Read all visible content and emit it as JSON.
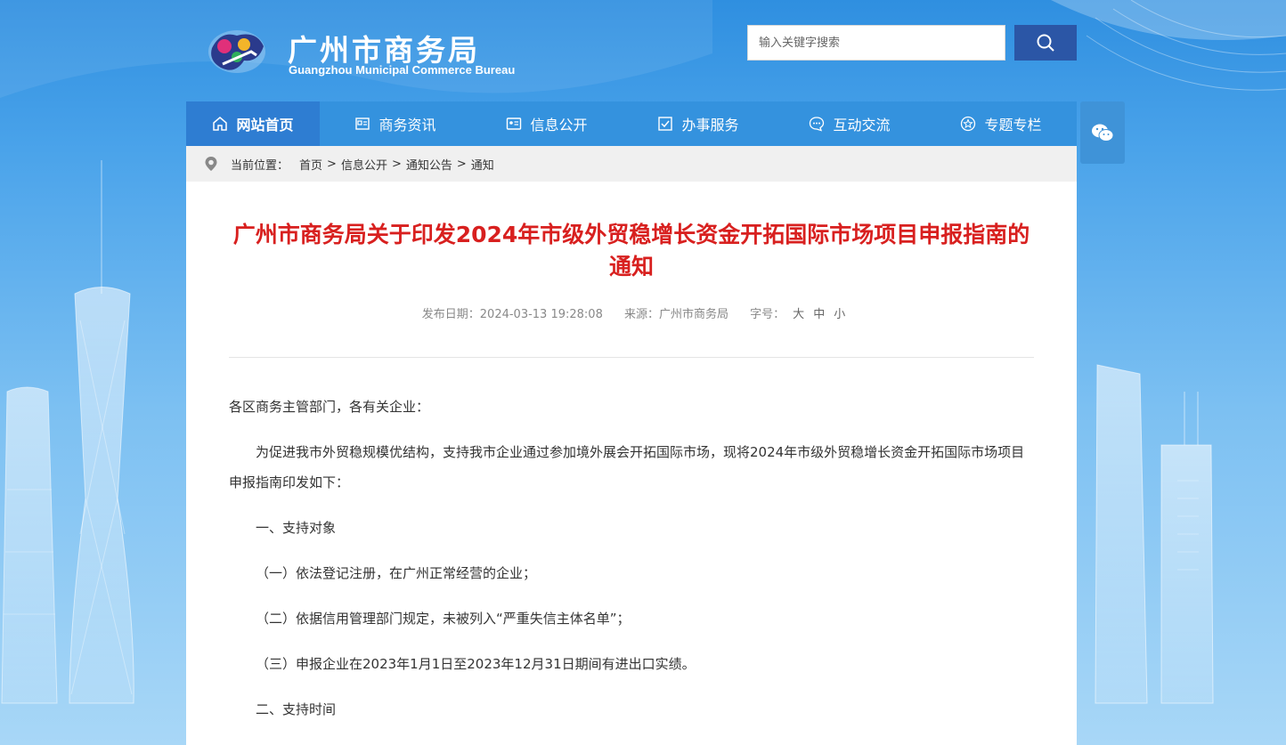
{
  "header": {
    "title": "广州市商务局",
    "subtitle": "Guangzhou Municipal Commerce Bureau",
    "search_placeholder": "输入关键字搜索"
  },
  "nav": {
    "items": [
      {
        "label": "网站首页",
        "icon": "home-icon",
        "active": true
      },
      {
        "label": "商务资讯",
        "icon": "news-icon"
      },
      {
        "label": "信息公开",
        "icon": "info-card-icon"
      },
      {
        "label": "办事服务",
        "icon": "checkbox-icon"
      },
      {
        "label": "互动交流",
        "icon": "chat-bubble-icon"
      },
      {
        "label": "专题专栏",
        "icon": "star-icon"
      }
    ]
  },
  "breadcrumb": {
    "prefix": "当前位置：",
    "items": [
      "首页",
      "信息公开",
      "通知公告",
      "通知"
    ],
    "sep": ">"
  },
  "article": {
    "title": "广州市商务局关于印发2024年市级外贸稳增长资金开拓国际市场项目申报指南的通知",
    "publish_date": "发布日期：2024-03-13 19:28:08",
    "source": "来源：广州市商务局",
    "font_size_label": "字号：",
    "size_large": "大",
    "size_medium": "中",
    "size_small": "小",
    "paragraphs": [
      "各区商务主管部门，各有关企业：",
      "为促进我市外贸稳规模优结构，支持我市企业通过参加境外展会开拓国际市场，现将2024年市级外贸稳增长资金开拓国际市场项目申报指南印发如下：",
      "一、支持对象",
      "（一）依法登记注册，在广州正常经营的企业；",
      "（二）依据信用管理部门规定，未被列入“严重失信主体名单”；",
      "（三）申报企业在2023年1月1日至2023年12月31日期间有进出口实绩。",
      "二、支持时间"
    ]
  },
  "colors": {
    "nav_bg": "#3492de",
    "title_red": "#d8201f",
    "search_btn": "#2b56a6"
  }
}
